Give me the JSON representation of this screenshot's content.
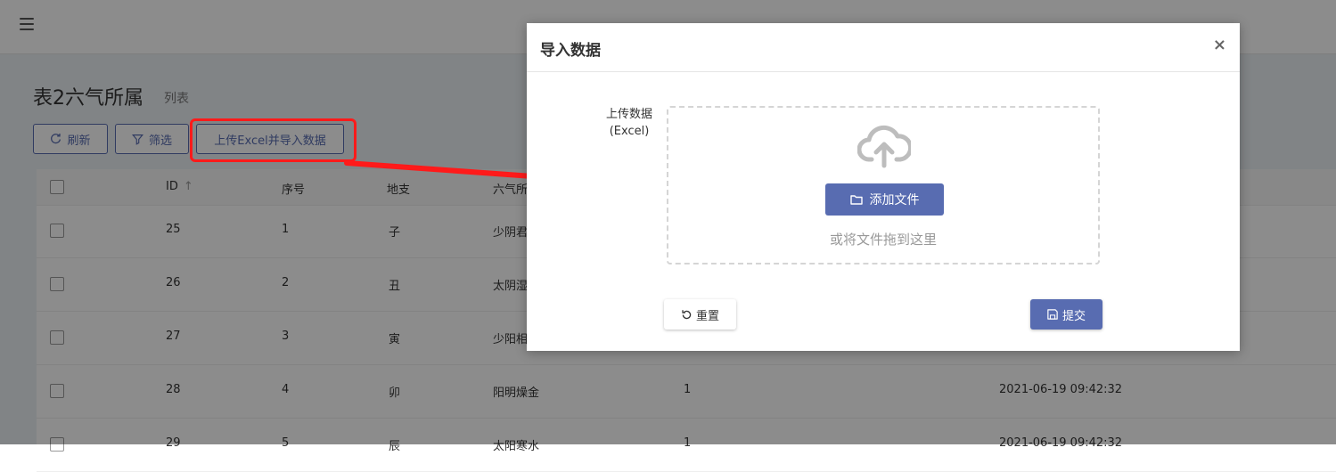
{
  "page": {
    "title": "表2六气所属",
    "subtitle": "列表"
  },
  "toolbar": {
    "refresh_label": "刷新",
    "filter_label": "筛选",
    "upload_label": "上传Excel并导入数据"
  },
  "table": {
    "headers": [
      "ID",
      "序号",
      "地支",
      "六气所"
    ],
    "rows": [
      {
        "id": "25",
        "seq": "1",
        "branch": "子",
        "qi": "少阴君"
      },
      {
        "id": "26",
        "seq": "2",
        "branch": "丑",
        "qi": "太阴湿"
      },
      {
        "id": "27",
        "seq": "3",
        "branch": "寅",
        "qi": "少阳相"
      },
      {
        "id": "28",
        "seq": "4",
        "branch": "卯",
        "qi": "阳明燥金",
        "extra": "1",
        "time": "2021-06-19 09:42:32"
      },
      {
        "id": "29",
        "seq": "5",
        "branch": "辰",
        "qi": "太阳寒水",
        "extra": "1",
        "time": "2021-06-19 09:42:32"
      }
    ]
  },
  "modal": {
    "title": "导入数据",
    "close": "×",
    "field_label_line1": "上传数据",
    "field_label_line2": "(Excel)",
    "add_file_label": "添加文件",
    "drop_hint": "或将文件拖到这里",
    "reset_label": "重置",
    "submit_label": "提交"
  },
  "colors": {
    "accent": "#586cb1",
    "annotation": "#ff1a1a"
  }
}
